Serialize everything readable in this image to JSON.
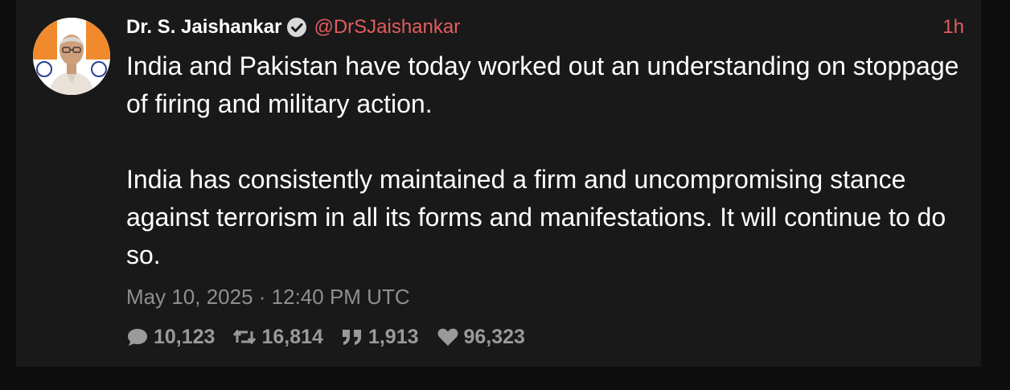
{
  "tweet": {
    "author_name": "Dr. S. Jaishankar",
    "handle": "@DrSJaishankar",
    "relative_time": "1h",
    "verified": true,
    "paragraphs": [
      "India and Pakistan have today worked out an understanding on stoppage of firing and military action.",
      "India has consistently maintained a firm and uncompromising stance against terrorism in all its forms and manifestations. It will continue to do so."
    ],
    "timestamp": "May 10, 2025 · 12:40 PM UTC",
    "stats": {
      "replies": "10,123",
      "retweets": "16,814",
      "quotes": "1,913",
      "likes": "96,323"
    }
  },
  "icons": {
    "verified": "verified-badge-icon",
    "replies": "comment-bubble-icon",
    "retweets": "retweet-icon",
    "quotes": "quote-icon",
    "likes": "heart-icon"
  },
  "colors": {
    "page_background": "#0d0d0d",
    "card_background": "#191919",
    "accent": "#e35d5d",
    "text_primary": "#ffffff",
    "text_muted": "#8f8f8f"
  }
}
